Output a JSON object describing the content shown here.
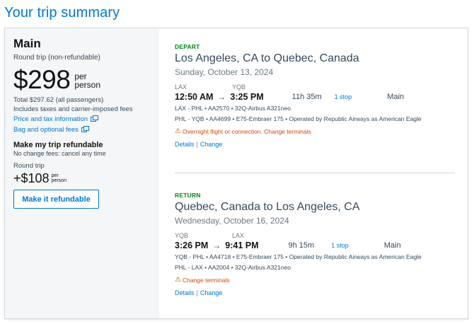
{
  "page": {
    "title": "Your trip summary"
  },
  "fare": {
    "name": "Main",
    "type": "Round trip (non-refundable)",
    "price": "$298",
    "per": "per",
    "person": "person",
    "total": "Total $297.62 (all passengers)",
    "taxes_note": "Includes taxes and carrier-imposed fees",
    "price_tax_link": "Price and tax information",
    "bag_link": "Bag and optional fees"
  },
  "refundable": {
    "heading": "Make my trip refundable",
    "subtext": "No change fees: cancel any time",
    "trip_type": "Round trip",
    "price": "+$108",
    "per": "per",
    "person": "person",
    "button": "Make it refundable"
  },
  "depart": {
    "label": "DEPART",
    "route": "Los Angeles, CA to Quebec, Canada",
    "date": "Sunday, October 13, 2024",
    "origin_code": "LAX",
    "dest_code": "YQB",
    "dep_time": "12:50 AM",
    "arr_time": "3:25 PM",
    "duration": "11h 35m",
    "stops": "1 stop",
    "cabin": "Main",
    "segments": [
      "LAX - PHL • AA2570 • 32Q-Airbus A321neo",
      "PHL - YQB • AA4699 • E75-Embraer 175 • Operated by Republic Airways as American Eagle"
    ],
    "warning": "Overnight flight or connection. Change terminals",
    "details": "Details",
    "change": "Change"
  },
  "return": {
    "label": "RETURN",
    "route": "Quebec, Canada to Los Angeles, CA",
    "date": "Wednesday, October 16, 2024",
    "origin_code": "YQB",
    "dest_code": "LAX",
    "dep_time": "3:26 PM",
    "arr_time": "9:41 PM",
    "duration": "9h 15m",
    "stops": "1 stop",
    "cabin": "Main",
    "segments": [
      "YQB - PHL • AA4718 • E75-Embraer 175 • Operated by Republic Airways as American Eagle",
      "PHL - LAX • AA2004 • 32Q-Airbus A321neo"
    ],
    "warning": "Change terminals",
    "details": "Details",
    "change": "Change"
  },
  "colors": {
    "accent": "#0078d2",
    "depart_label": "#008516",
    "warning": "#d14904",
    "panel": "#f4f6f7"
  }
}
